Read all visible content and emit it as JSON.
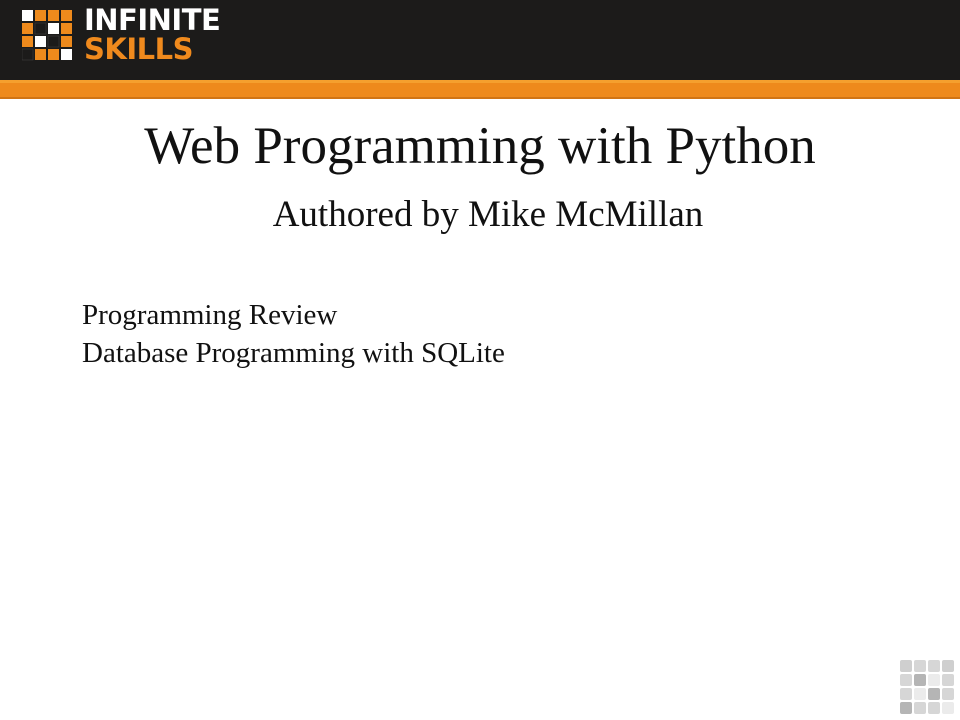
{
  "brand": {
    "name_line1": "INFINITE",
    "name_line2": "SKILLS",
    "logo_icon": "grid-logo-icon",
    "colors": {
      "header_bg": "#1c1b1a",
      "accent": "#ee8a1c",
      "text": "#111111"
    }
  },
  "slide": {
    "title": "Web Programming with Python",
    "subtitle": "Authored by Mike McMillan",
    "topics": [
      "Programming Review",
      "Database Programming with SQLite"
    ]
  },
  "watermark": {
    "icon": "grid-watermark-icon"
  }
}
